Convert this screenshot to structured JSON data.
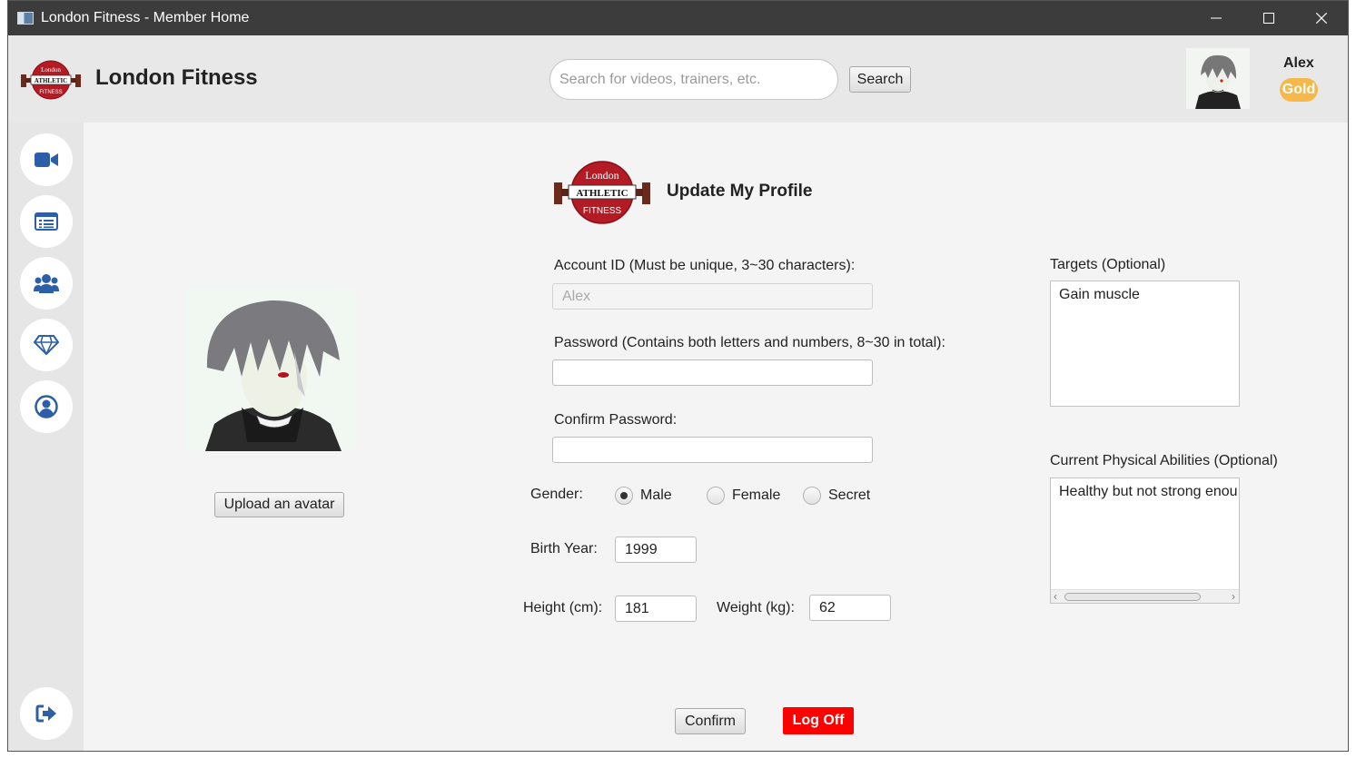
{
  "window": {
    "title": "London Fitness - Member Home"
  },
  "header": {
    "brand": "London Fitness",
    "search_placeholder": "Search for videos, trainers, etc.",
    "search_value": "",
    "search_button": "Search",
    "user_name": "Alex",
    "membership": "Gold"
  },
  "logo": {
    "top": "London",
    "middle": "ATHLETIC",
    "bottom": "FITNESS"
  },
  "sidebar": {
    "items": [
      {
        "icon": "video-camera-icon"
      },
      {
        "icon": "list-icon"
      },
      {
        "icon": "users-icon"
      },
      {
        "icon": "diamond-icon"
      },
      {
        "icon": "user-circle-icon"
      }
    ],
    "logout_icon": "sign-out-icon"
  },
  "avatar": {
    "upload_button": "Upload an avatar"
  },
  "form": {
    "title": "Update My Profile",
    "account_id_label": "Account ID (Must be unique, 3~30 characters):",
    "account_id_value": "Alex",
    "password_label": "Password (Contains both letters and numbers, 8~30 in total):",
    "password_value": "",
    "confirm_password_label": "Confirm Password:",
    "confirm_password_value": "",
    "gender_label": "Gender:",
    "gender_options": [
      "Male",
      "Female",
      "Secret"
    ],
    "gender_selected": "Male",
    "birth_year_label": "Birth Year:",
    "birth_year_value": "1999",
    "height_label": "Height (cm):",
    "height_value": "181",
    "weight_label": "Weight (kg):",
    "weight_value": "62",
    "targets_label": "Targets (Optional)",
    "targets_value": "Gain muscle",
    "abilities_label": "Current Physical Abilities (Optional)",
    "abilities_value": "Healthy but not strong enou",
    "confirm_button": "Confirm",
    "logoff_button": "Log Off"
  },
  "colors": {
    "titlebar": "#3c3c3c",
    "sidebar_icon": "#2d5fa8",
    "badge": "#f7b84b",
    "logoff": "#ff0000",
    "logo_red": "#b31b25"
  }
}
